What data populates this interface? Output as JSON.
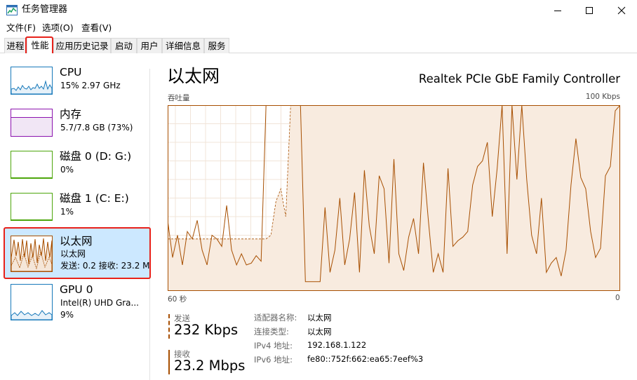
{
  "window": {
    "title": "任务管理器"
  },
  "menu": [
    "文件(F)",
    "选项(O)",
    "查看(V)"
  ],
  "tabs": [
    "进程",
    "性能",
    "应用历史记录",
    "启动",
    "用户",
    "详细信息",
    "服务"
  ],
  "active_tab": "性能",
  "sidebar": {
    "items": [
      {
        "title": "CPU",
        "line1": "15% 2.97 GHz",
        "line2": "",
        "color": "#1779ba"
      },
      {
        "title": "内存",
        "line1": "5.7/7.8 GB (73%)",
        "line2": "",
        "color": "#8b12ae"
      },
      {
        "title": "磁盘 0 (D: G:)",
        "line1": "0%",
        "line2": "",
        "color": "#4da60c"
      },
      {
        "title": "磁盘 1 (C: E:)",
        "line1": "1%",
        "line2": "",
        "color": "#4da60c"
      },
      {
        "title": "以太网",
        "line1": "以太网",
        "line2": "发送: 0.2  接收: 23.2 M",
        "color": "#a74f01"
      },
      {
        "title": "GPU 0",
        "line1": "Intel(R) UHD Gra...",
        "line2": "9%",
        "color": "#1779ba"
      }
    ]
  },
  "main": {
    "title": "以太网",
    "adapter": "Realtek PCIe GbE Family Controller",
    "graph_label": "吞吐量",
    "graph_max": "100 Kbps",
    "axis_left": "60 秒",
    "axis_right": "0",
    "accent_color": "#a74f01"
  },
  "stats": {
    "send_label": "发送",
    "send_value": "232 Kbps",
    "recv_label": "接收",
    "recv_value": "23.2 Mbps"
  },
  "properties": {
    "adapter_name_label": "适配器名称:",
    "adapter_name_value": "以太网",
    "conn_type_label": "连接类型:",
    "conn_type_value": "以太网",
    "ipv4_label": "IPv4 地址:",
    "ipv4_value": "192.168.1.122",
    "ipv6_label": "IPv6 地址:",
    "ipv6_value": "fe80::752f:662:ea65:7eef%3"
  },
  "chart_data": {
    "type": "line",
    "ylim": [
      0,
      100
    ],
    "series": [
      {
        "values": [
          38,
          18,
          30,
          14,
          32,
          28,
          38,
          22,
          14,
          30,
          28,
          24,
          46,
          22,
          14,
          20,
          14,
          15,
          19,
          16,
          100,
          100,
          100,
          100,
          100,
          100,
          100,
          100,
          5,
          5,
          5,
          5,
          45,
          10,
          22,
          50,
          14,
          28,
          53,
          10,
          65,
          35,
          20,
          62,
          55,
          15,
          71,
          20,
          11,
          29,
          39,
          20,
          69,
          38,
          10,
          20,
          10,
          66,
          24,
          27,
          29,
          32,
          57,
          67,
          70,
          80,
          40,
          66,
          100,
          20,
          100,
          60,
          100,
          60,
          30,
          20,
          50,
          10,
          15,
          18,
          8,
          22,
          57,
          82,
          61,
          55,
          32,
          18,
          23,
          62,
          67,
          97,
          100
        ]
      },
      {
        "values": [
          28,
          28,
          28,
          28,
          28,
          28,
          28,
          28,
          28,
          28,
          28,
          28,
          28,
          28,
          28,
          28,
          28,
          28,
          28,
          28,
          28,
          30,
          48,
          55,
          40,
          100,
          100,
          100,
          100,
          100,
          100,
          100,
          100,
          100,
          100,
          100,
          100,
          100,
          100,
          100,
          100,
          100,
          100,
          100,
          100,
          100,
          100,
          100,
          100,
          100,
          100,
          100,
          100,
          100,
          100,
          100,
          100,
          100,
          100,
          100,
          100,
          100,
          100,
          100,
          100,
          100,
          100,
          100,
          100,
          100,
          100,
          100,
          100,
          100,
          100,
          100,
          100,
          100,
          100,
          100,
          100,
          100,
          100,
          100,
          100,
          100,
          100,
          100,
          100,
          100,
          100,
          100,
          100
        ]
      }
    ]
  }
}
